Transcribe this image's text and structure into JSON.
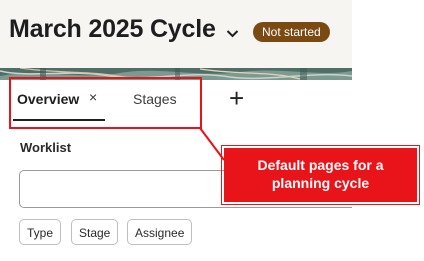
{
  "header": {
    "title": "March 2025 Cycle",
    "status_badge": "Not started",
    "colors": {
      "badge_bg": "#7a4a12",
      "header_bg": "#f7f5f2"
    }
  },
  "tabs": {
    "items": [
      {
        "label": "Overview",
        "active": true,
        "closable": true,
        "close_glyph": "×"
      },
      {
        "label": "Stages",
        "active": false
      }
    ],
    "add_glyph": "+"
  },
  "worklist": {
    "title": "Worklist",
    "search_value": "",
    "filters": [
      "Type",
      "Stage",
      "Assignee"
    ]
  },
  "annotation": {
    "text_line1": "Default pages for a",
    "text_line2": "planning cycle",
    "color": "#e8141a"
  },
  "icons": {
    "dropdown": "chevron-down-icon",
    "close": "close-icon",
    "add": "plus-icon"
  }
}
